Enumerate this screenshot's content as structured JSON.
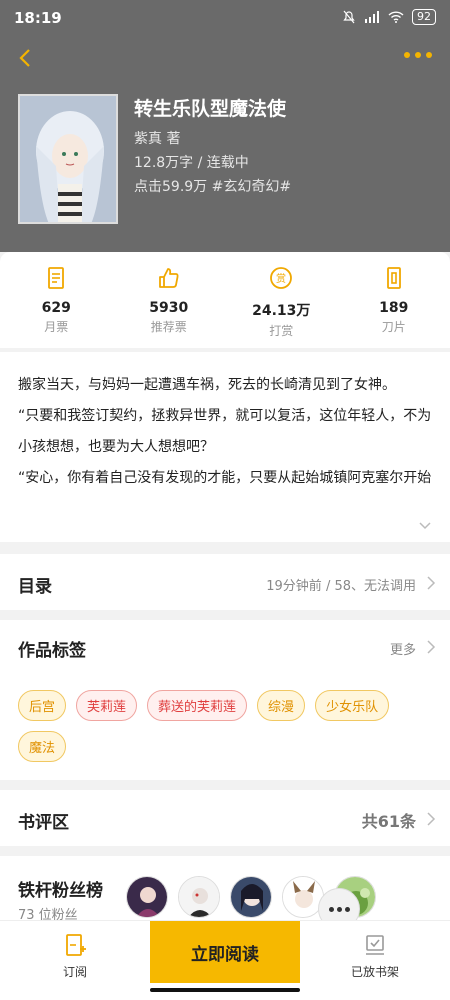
{
  "status": {
    "time": "18:19",
    "battery": "92"
  },
  "book": {
    "title": "转生乐队型魔法使",
    "author_line": "紫真  著",
    "words_line": "12.8万字 / 连载中",
    "clicks_line": "点击59.9万  #玄幻奇幻#"
  },
  "stats": [
    {
      "icon": "monthly-ticket-icon",
      "value": "629",
      "label": "月票"
    },
    {
      "icon": "thumbs-up-icon",
      "value": "5930",
      "label": "推荐票"
    },
    {
      "icon": "reward-coin-icon",
      "value": "24.13万",
      "label": "打赏"
    },
    {
      "icon": "blade-card-icon",
      "value": "189",
      "label": "刀片"
    }
  ],
  "intro": {
    "text": "搬家当天，与妈妈一起遭遇车祸，死去的长崎清见到了女神。\n“只要和我签订契约，拯救异世界，就可以复活，这位年轻人，不为小孩想想，也要为大人想想吧？\n“安心，你有着自己没有发现的才能，只要从起始城镇阿克塞尔开始锻炼，很快能发掘出天赋，击败魔王，拯救异世界了…"
  },
  "catalog": {
    "title": "目录",
    "latest": "19分钟前 / 58、无法调用"
  },
  "tags_section": {
    "title": "作品标签",
    "more": "更多",
    "tags": [
      {
        "text": "后宫",
        "style": "y"
      },
      {
        "text": "芙莉莲",
        "style": "r"
      },
      {
        "text": "葬送的芙莉莲",
        "style": "r"
      },
      {
        "text": "综漫",
        "style": "y"
      },
      {
        "text": "少女乐队",
        "style": "y"
      },
      {
        "text": "魔法",
        "style": "y"
      }
    ]
  },
  "reviews": {
    "title": "书评区",
    "count": "共61条"
  },
  "fans": {
    "title": "铁杆粉丝榜",
    "count": "73 位粉丝"
  },
  "bottom": {
    "subscribe": "订阅",
    "read": "立即阅读",
    "shelf": "已放书架"
  },
  "colors": {
    "accent": "#f6b800",
    "header_bg": "#6a6a6a"
  }
}
